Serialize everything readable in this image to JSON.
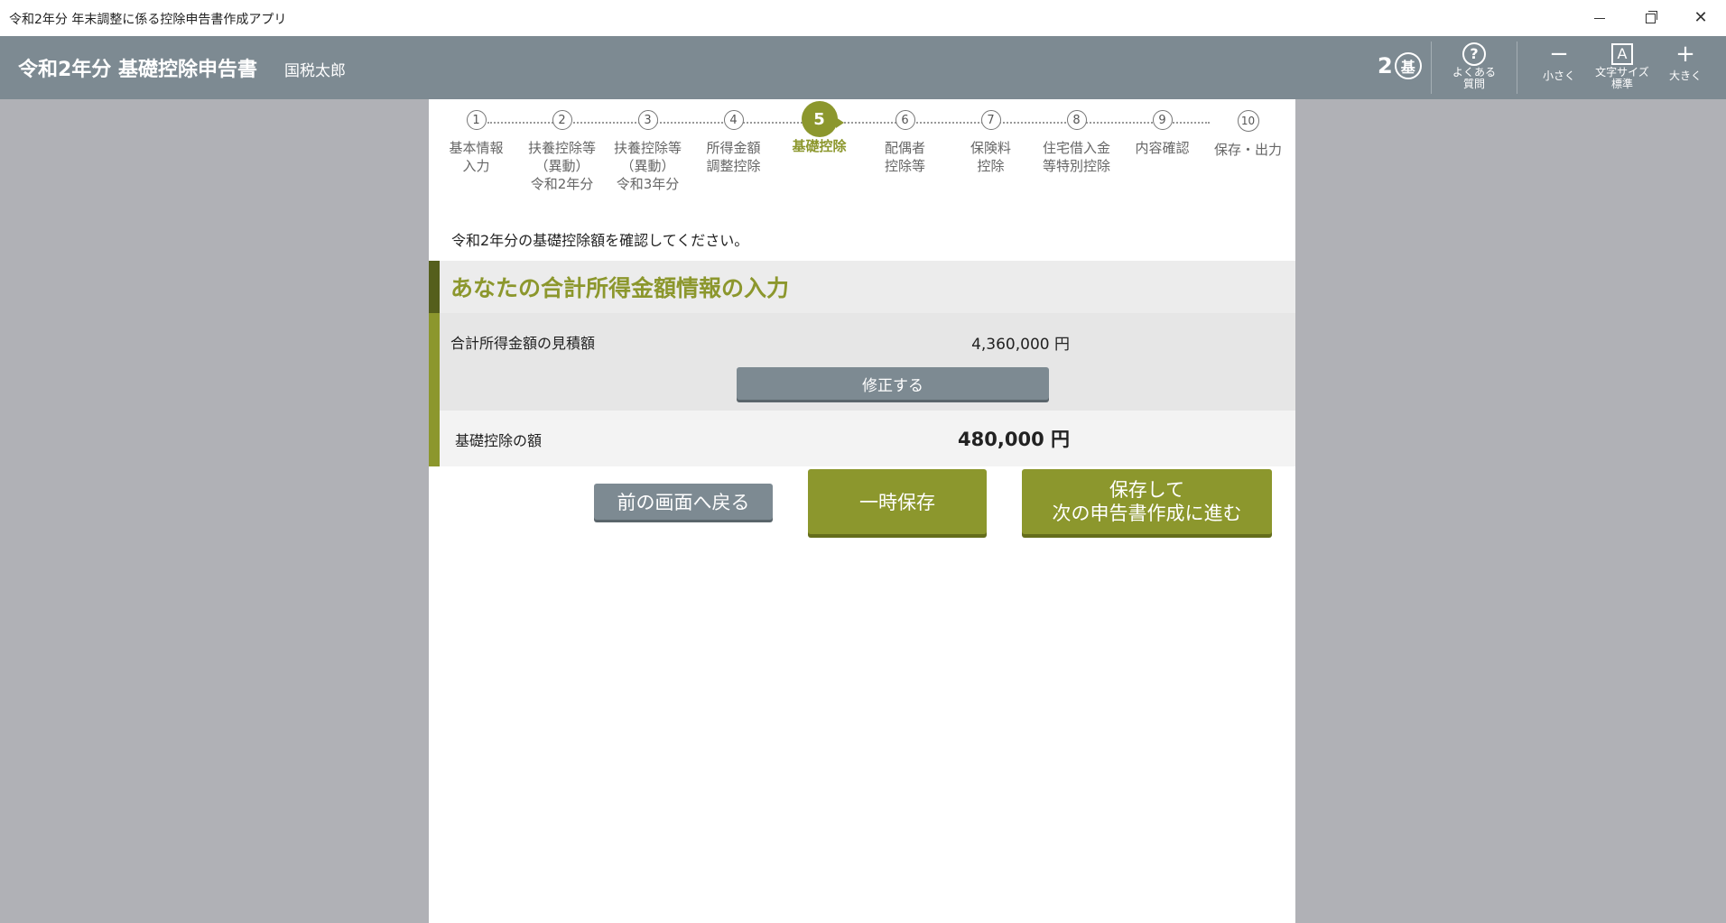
{
  "window": {
    "title": "令和2年分 年末調整に係る控除申告書作成アプリ",
    "minimize": "—",
    "maximize": "❐",
    "close": "✕"
  },
  "header": {
    "title": "令和2年分 基礎控除申告書",
    "user_name": "国税太郎",
    "badge_number": "2",
    "badge_char": "基",
    "faq_label_1": "よくある",
    "faq_label_2": "質問",
    "smaller_label": "小さく",
    "font_label_1": "文字サイズ",
    "font_label_2": "標準",
    "larger_label": "大きく"
  },
  "steps": [
    {
      "num": "1",
      "label_1": "基本情報",
      "label_2": "入力",
      "label_3": ""
    },
    {
      "num": "2",
      "label_1": "扶養控除等",
      "label_2": "（異動）",
      "label_3": "令和2年分"
    },
    {
      "num": "3",
      "label_1": "扶養控除等",
      "label_2": "（異動）",
      "label_3": "令和3年分"
    },
    {
      "num": "4",
      "label_1": "所得金額",
      "label_2": "調整控除",
      "label_3": ""
    },
    {
      "num": "5",
      "label_1": "基礎控除",
      "label_2": "",
      "label_3": ""
    },
    {
      "num": "6",
      "label_1": "配偶者",
      "label_2": "控除等",
      "label_3": ""
    },
    {
      "num": "7",
      "label_1": "保険料",
      "label_2": "控除",
      "label_3": ""
    },
    {
      "num": "8",
      "label_1": "住宅借入金",
      "label_2": "等特別控除",
      "label_3": ""
    },
    {
      "num": "9",
      "label_1": "内容確認",
      "label_2": "",
      "label_3": ""
    },
    {
      "num": "10",
      "label_1": "保存・出力",
      "label_2": "",
      "label_3": ""
    }
  ],
  "main": {
    "instruction": "令和2年分の基礎控除額を確認してください。",
    "section_title": "あなたの合計所得金額情報の入力",
    "income_label": "合計所得金額の見積額",
    "income_value": "4,360,000 円",
    "fix_button": "修正する",
    "deduction_label": "基礎控除の額",
    "deduction_value": "480,000 円"
  },
  "actions": {
    "back": "前の画面へ戻る",
    "temp_save": "一時保存",
    "next_line_1": "保存して",
    "next_line_2": "次の申告書作成に進む"
  },
  "colors": {
    "accent": "#8c972d",
    "header_bg": "#7d8a92",
    "backdrop": "#b0b1b6"
  }
}
